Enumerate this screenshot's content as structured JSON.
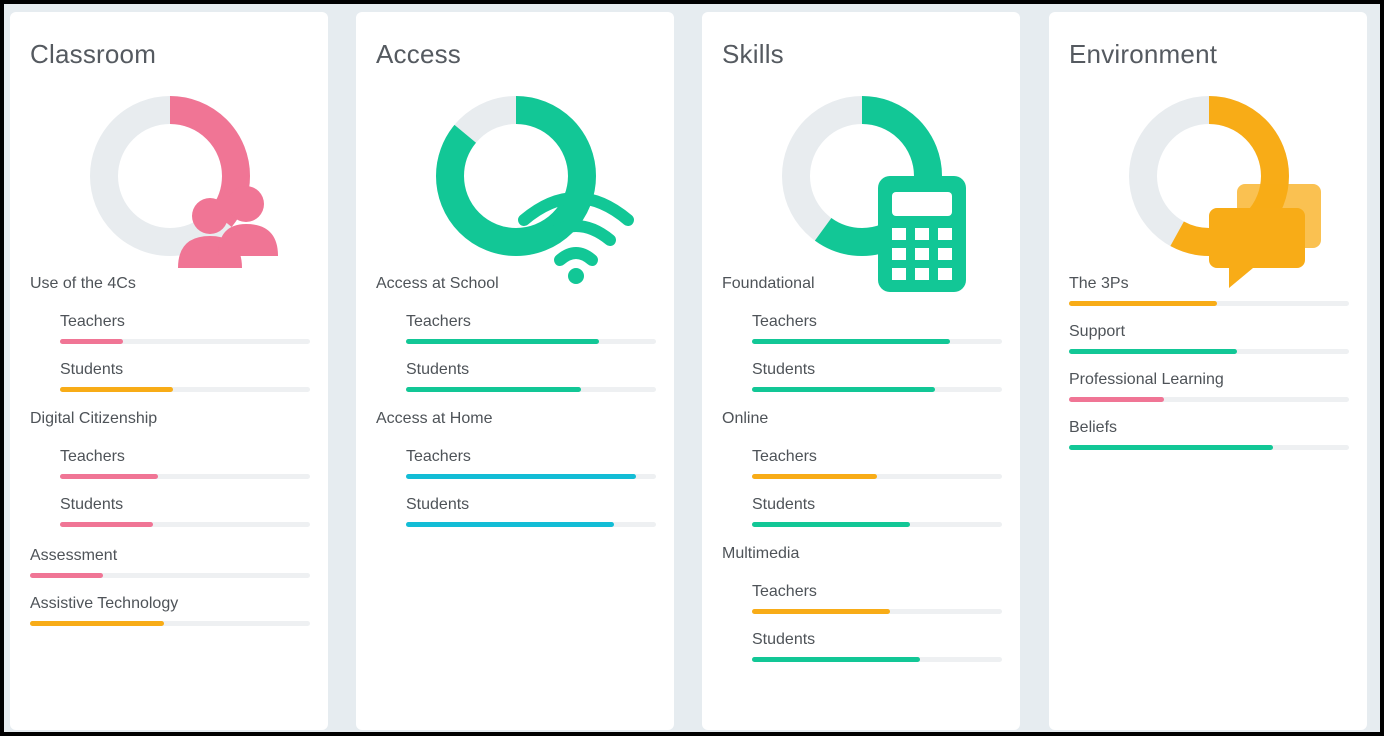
{
  "colors": {
    "pink": "#f07595",
    "orange": "#f8ac17",
    "green": "#12c796",
    "cyan": "#13bdd6",
    "ring_track": "#e8ecef"
  },
  "cards": [
    {
      "title": "Classroom",
      "donut": {
        "value": 0.36,
        "color": "#f07595",
        "icon": "users-icon"
      },
      "sections": [
        {
          "label": "Use of the 4Cs",
          "items": [
            {
              "label": "Teachers",
              "value": 0.25,
              "color": "#f07595"
            },
            {
              "label": "Students",
              "value": 0.45,
              "color": "#f8ac17"
            }
          ]
        },
        {
          "label": "Digital Citizenship",
          "items": [
            {
              "label": "Teachers",
              "value": 0.39,
              "color": "#f07595"
            },
            {
              "label": "Students",
              "value": 0.37,
              "color": "#f07595"
            }
          ]
        }
      ],
      "flat": [
        {
          "label": "Assessment",
          "value": 0.26,
          "color": "#f07595"
        },
        {
          "label": "Assistive Technology",
          "value": 0.48,
          "color": "#f8ac17"
        }
      ]
    },
    {
      "title": "Access",
      "donut": {
        "value": 0.86,
        "color": "#12c796",
        "icon": "wifi-icon"
      },
      "sections": [
        {
          "label": "Access at School",
          "items": [
            {
              "label": "Teachers",
              "value": 0.77,
              "color": "#12c796"
            },
            {
              "label": "Students",
              "value": 0.7,
              "color": "#12c796"
            }
          ]
        },
        {
          "label": "Access at Home",
          "items": [
            {
              "label": "Teachers",
              "value": 0.92,
              "color": "#13bdd6"
            },
            {
              "label": "Students",
              "value": 0.83,
              "color": "#13bdd6"
            }
          ]
        }
      ],
      "flat": []
    },
    {
      "title": "Skills",
      "donut": {
        "value": 0.6,
        "color": "#12c796",
        "icon": "calculator-icon"
      },
      "sections": [
        {
          "label": "Foundational",
          "items": [
            {
              "label": "Teachers",
              "value": 0.79,
              "color": "#12c796"
            },
            {
              "label": "Students",
              "value": 0.73,
              "color": "#12c796"
            }
          ]
        },
        {
          "label": "Online",
          "items": [
            {
              "label": "Teachers",
              "value": 0.5,
              "color": "#f8ac17"
            },
            {
              "label": "Students",
              "value": 0.63,
              "color": "#12c796"
            }
          ]
        },
        {
          "label": "Multimedia",
          "items": [
            {
              "label": "Teachers",
              "value": 0.55,
              "color": "#f8ac17"
            },
            {
              "label": "Students",
              "value": 0.67,
              "color": "#12c796"
            }
          ]
        }
      ],
      "flat": []
    },
    {
      "title": "Environment",
      "donut": {
        "value": 0.58,
        "color": "#f8ac17",
        "icon": "chat-bubbles-icon"
      },
      "sections": [],
      "flat": [
        {
          "label": "The 3Ps",
          "value": 0.53,
          "color": "#f8ac17"
        },
        {
          "label": "Support",
          "value": 0.6,
          "color": "#12c796"
        },
        {
          "label": "Professional Learning",
          "value": 0.34,
          "color": "#f07595"
        },
        {
          "label": "Beliefs",
          "value": 0.73,
          "color": "#12c796"
        }
      ]
    }
  ]
}
